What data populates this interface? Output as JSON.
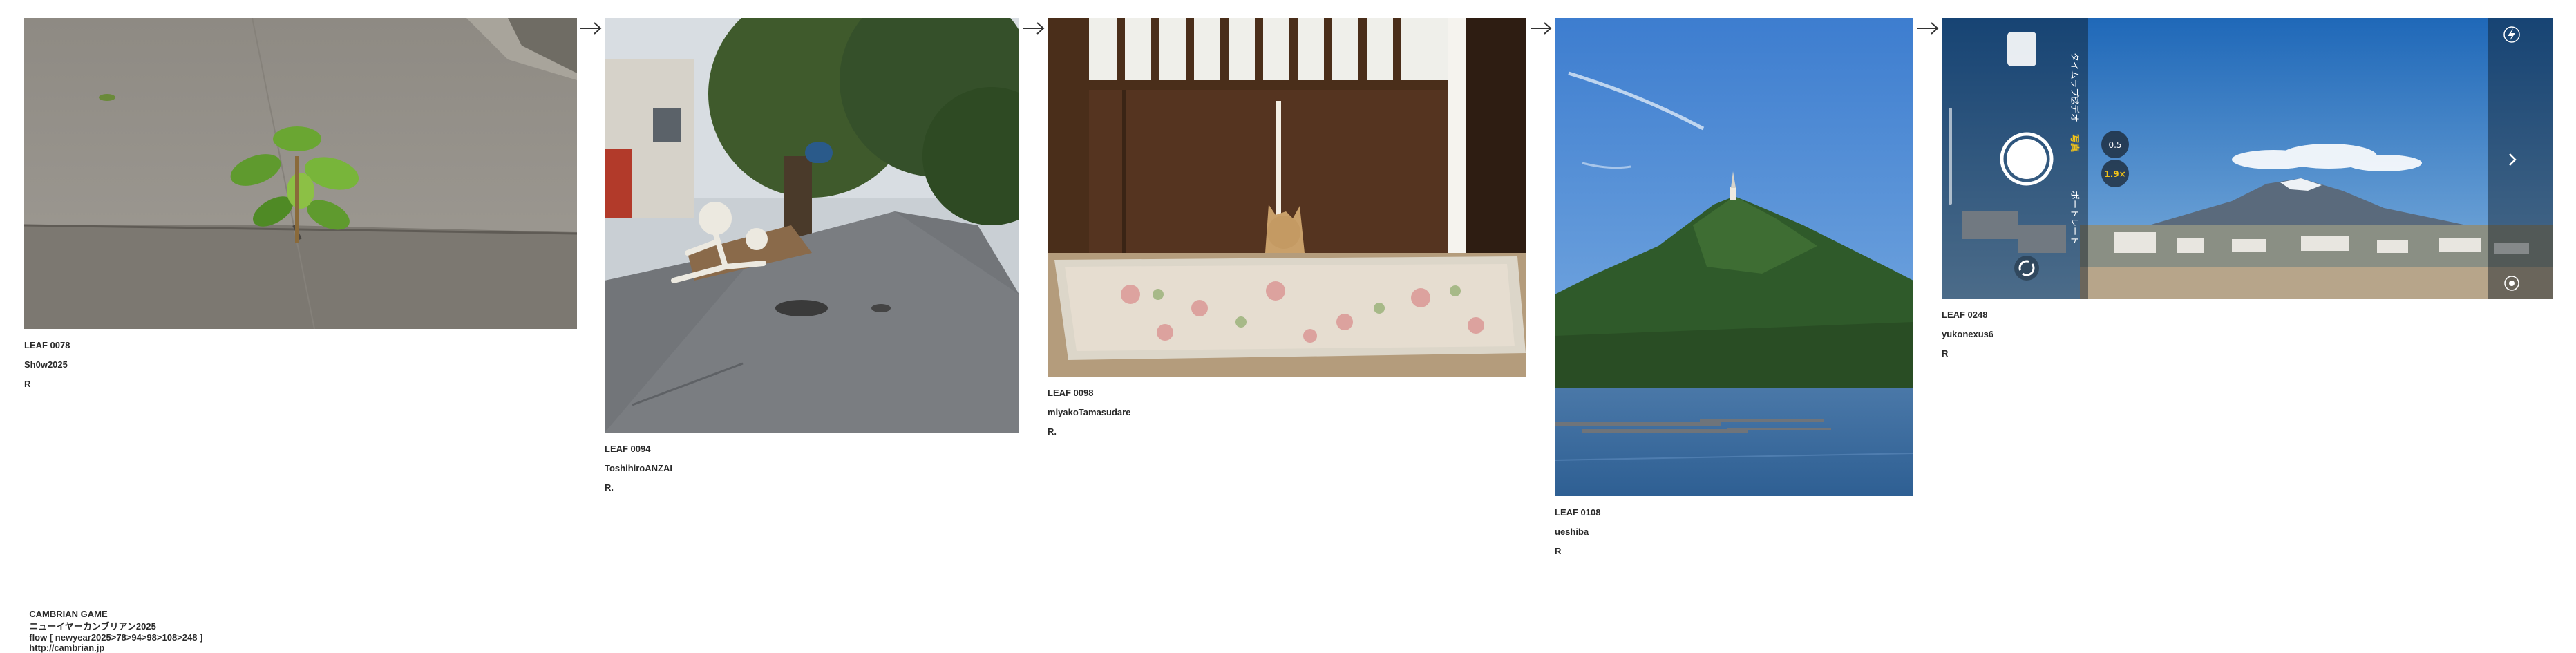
{
  "leaves": [
    {
      "leaf": "LEAF 0078",
      "author": "Sh0w2025",
      "mark": "R",
      "photo": "sprout-through-concrete"
    },
    {
      "leaf": "LEAF 0094",
      "author": "ToshihiroANZAI",
      "mark": "R.",
      "photo": "street-with-skeleton-decoration"
    },
    {
      "leaf": "LEAF 0098",
      "author": "miyakoTamasudare",
      "mark": "R.",
      "photo": "cat-peeking-under-sliding-door"
    },
    {
      "leaf": "LEAF 0108",
      "author": "ueshiba",
      "mark": "R",
      "photo": "green-hill-with-tower-over-bay"
    },
    {
      "leaf": "LEAF 0248",
      "author": "yukonexus6",
      "mark": "R",
      "photo": "camera-app-view-of-mount-fuji"
    }
  ],
  "camera_ui": {
    "zoom_low": "0.5",
    "zoom_high": "1.9×",
    "modes": [
      "写真",
      "ポートレート",
      "ビデオ",
      "タイムラプス"
    ]
  },
  "footer": {
    "game": "CAMBRIAN GAME",
    "title": "ニューイヤーカンブリアン2025",
    "flow": "flow [ newyear2025>78>94>98>108>248 ]",
    "url": "http://cambrian.jp"
  }
}
